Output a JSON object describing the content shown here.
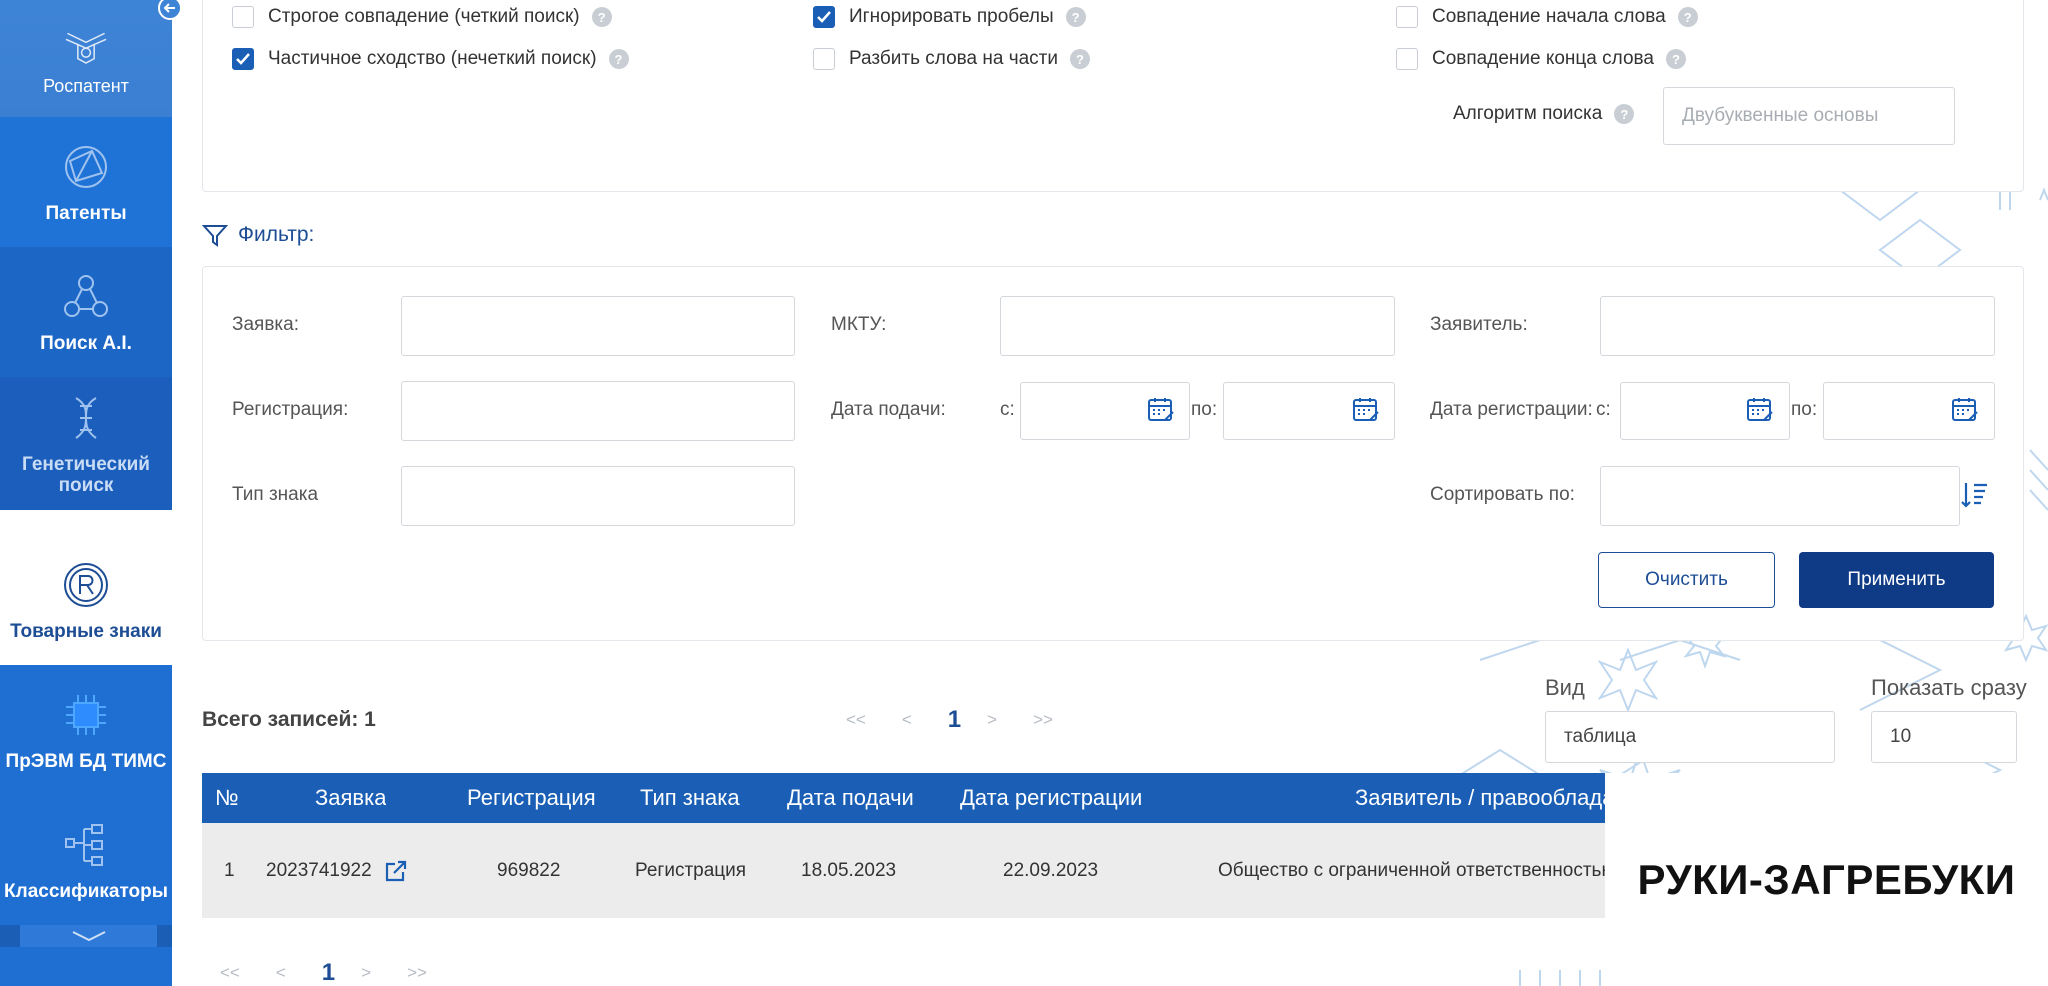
{
  "sidebar": {
    "logo_label": "Роспатент",
    "items": [
      {
        "label": "Патенты",
        "icon": "globe-network-icon"
      },
      {
        "label": "Поиск A.I.",
        "icon": "ai-nodes-icon"
      },
      {
        "label": "Генетический поиск",
        "icon": "dna-icon"
      },
      {
        "label": "Товарные знаки",
        "icon": "registered-mark-icon"
      },
      {
        "label": "ПрЭВМ БД ТИМС",
        "icon": "chip-icon"
      },
      {
        "label": "Классификаторы",
        "icon": "classifier-tree-icon"
      }
    ]
  },
  "options": {
    "strict": {
      "label": "Строгое совпадение (четкий поиск)",
      "checked": false
    },
    "fuzzy": {
      "label": "Частичное сходство (нечеткий поиск)",
      "checked": true
    },
    "ignore_spaces": {
      "label": "Игнорировать пробелы",
      "checked": true
    },
    "split_words": {
      "label": "Разбить слова на части",
      "checked": false
    },
    "word_start": {
      "label": "Совпадение начала слова",
      "checked": false
    },
    "word_end": {
      "label": "Совпадение конца слова",
      "checked": false
    },
    "algorithm_label": "Алгоритм поиска",
    "algorithm_placeholder": "Двубуквенные основы"
  },
  "filter": {
    "title": "Фильтр:",
    "application_label": "Заявка:",
    "mktu_label": "МКТУ:",
    "applicant_label": "Заявитель:",
    "registration_label": "Регистрация:",
    "filing_date_label": "Дата подачи:",
    "registration_date_label": "Дата регистрации:",
    "from_label": "с:",
    "to_label": "по:",
    "mark_type_label": "Тип знака",
    "sort_label": "Сортировать по:",
    "clear_label": "Очистить",
    "apply_label": "Применить"
  },
  "results": {
    "total_label": "Всего записей: 1",
    "pager": {
      "first": "<<",
      "prev": "<",
      "current": "1",
      "next": ">",
      "last": ">>"
    },
    "view_label": "Вид",
    "view_value": "таблица",
    "show_label": "Показать сразу",
    "show_value": "10"
  },
  "table": {
    "columns": [
      "№",
      "Заявка",
      "Регистрация",
      "Тип знака",
      "Дата подачи",
      "Дата регистрации",
      "Заявитель / правообладатель"
    ],
    "rows": [
      {
        "num": "1",
        "application": "2023741922",
        "registration": "969822",
        "type": "Регистрация",
        "filing_date": "18.05.2023",
        "reg_date": "22.09.2023",
        "applicant": "Общество с ограниченной ответственностью"
      }
    ],
    "mark_image_text": "РУКИ-ЗАГРЕБУКИ"
  },
  "colors": {
    "primary": "#1a5fb5",
    "dark": "#0e3a86",
    "accent_text": "#1d4d94"
  }
}
